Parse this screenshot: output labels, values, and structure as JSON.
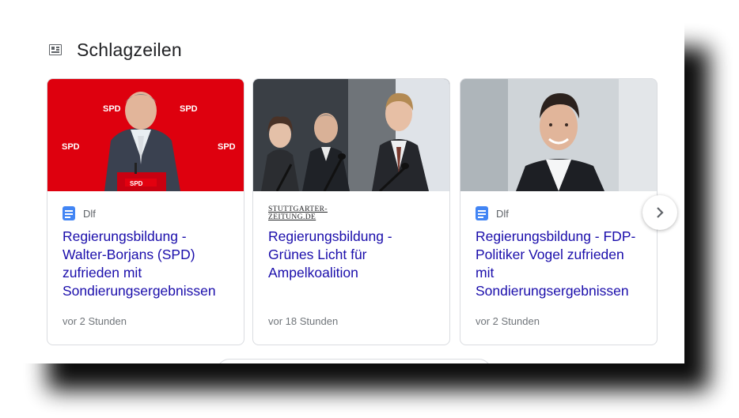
{
  "section": {
    "title": "Schlagzeilen",
    "icon": "newspaper-icon"
  },
  "cards": [
    {
      "image": "photo-speaker-at-red-podium",
      "source": {
        "name": "Dlf",
        "icon": "document-favicon-icon",
        "color": "#4285f4"
      },
      "headline": "Regierungsbildung - Walter-Borjans (SPD) zufrieden mit Sondierungsergebnissen",
      "time": "vor 2 Stunden",
      "image_text": "SPD"
    },
    {
      "image": "photo-three-politicians-at-microphones",
      "source": {
        "logo_line1": "STUTTGARTER-",
        "logo_line2": "ZEITUNG.DE"
      },
      "headline": "Regierungsbildung - Grünes Licht für Ampelkoalition",
      "time": "vor 18 Stunden"
    },
    {
      "image": "photo-smiling-man-portrait",
      "source": {
        "name": "Dlf",
        "icon": "document-favicon-icon",
        "color": "#4285f4"
      },
      "headline": "Regierungsbildung - FDP-Politiker Vogel zufrieden mit Sondierungsergebnissen",
      "time": "vor 2 Stunden"
    }
  ],
  "next_button": {
    "icon": "chevron-right-icon"
  },
  "colors": {
    "headline_link": "#1a0dab",
    "spd_red": "#e3000f",
    "border": "#dadce0"
  }
}
